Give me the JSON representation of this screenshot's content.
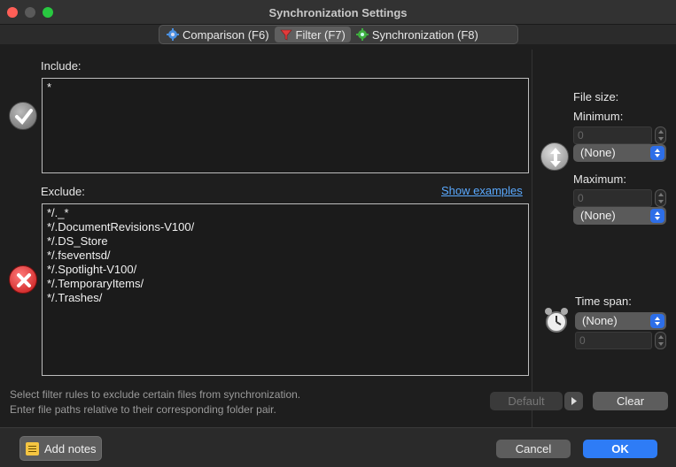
{
  "window": {
    "title": "Synchronization Settings"
  },
  "tabs": [
    {
      "label": "Comparison (F6)",
      "icon": "gear-icon",
      "active": false
    },
    {
      "label": "Filter (F7)",
      "icon": "funnel-icon",
      "active": true
    },
    {
      "label": "Synchronization (F8)",
      "icon": "sync-gear-icon",
      "active": false
    }
  ],
  "filter": {
    "include_label": "Include:",
    "include_lines": [
      "*"
    ],
    "exclude_label": "Exclude:",
    "show_examples": "Show examples",
    "exclude_lines": [
      "*/._*",
      "*/.DocumentRevisions-V100/",
      "*/.DS_Store",
      "*/.fseventsd/",
      "*/.Spotlight-V100/",
      "*/.TemporaryItems/",
      "*/.Trashes/"
    ]
  },
  "filesize": {
    "label": "File size:",
    "minimum_label": "Minimum:",
    "minimum_value": "0",
    "minimum_unit": "(None)",
    "maximum_label": "Maximum:",
    "maximum_value": "0",
    "maximum_unit": "(None)"
  },
  "timespan": {
    "label": "Time span:",
    "unit": "(None)",
    "value": "0"
  },
  "hint": {
    "line1": "Select filter rules to exclude certain files from synchronization.",
    "line2": "Enter file paths relative to their corresponding folder pair."
  },
  "buttons": {
    "default": "Default",
    "clear": "Clear",
    "add_notes": "Add notes",
    "cancel": "Cancel",
    "ok": "OK"
  },
  "colors": {
    "accent": "#2e7cf6",
    "link": "#5aa9ff",
    "exclude_icon": "#d42020"
  }
}
